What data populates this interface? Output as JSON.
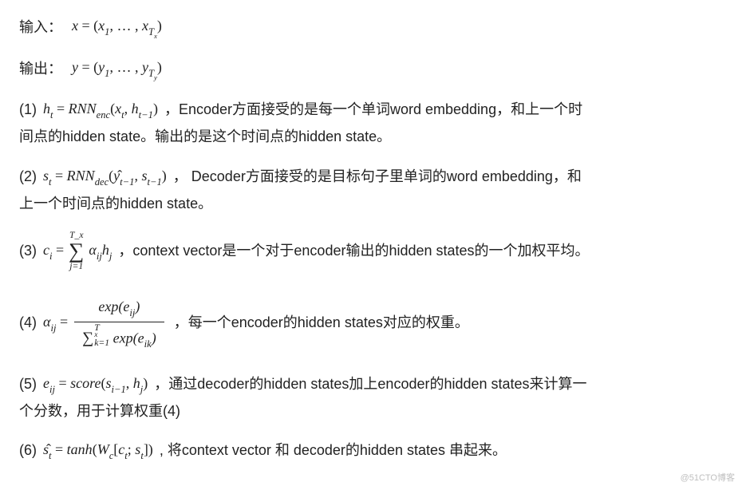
{
  "input_label": "输入：",
  "input_formula": "x = (x₁, …, x_{T_x})",
  "output_label": "输出：",
  "output_formula": "y = (y₁, …, y_{T_y})",
  "items": [
    {
      "num": "(1)",
      "formula": "h_t = RNN_{enc}(x_t, h_{t-1})",
      "desc": "，Encoder方面接受的是每一个单词word embedding，和上一个时",
      "desc2": "间点的hidden state。输出的是这个时间点的hidden state。"
    },
    {
      "num": "(2)",
      "formula": "s_t = RNN_{dec}(ŷ_{t-1}, s_{t-1})",
      "desc": "，  Decoder方面接受的是目标句子里单词的word embedding，和",
      "desc2": "上一个时间点的hidden state。"
    },
    {
      "num": "(3)",
      "formula_sum_top": "T_x",
      "formula_sum_bot": "j=1",
      "formula_lhs": "c_i =",
      "formula_rhs": "α_{ij} h_j",
      "desc": "，context vector是一个对于encoder输出的hidden states的一个加权平均。"
    },
    {
      "num": "(4)",
      "formula_lhs": "α_{ij} =",
      "frac_top": "exp(e_{ij})",
      "frac_bot_sum_top": "T_x",
      "frac_bot_sum_bot": "k=1",
      "frac_bot_rest": "exp(e_{ik})",
      "desc": "，每一个encoder的hidden states对应的权重。"
    },
    {
      "num": "(5)",
      "formula": "e_{ij} = score(s_{i-1}, h_j)",
      "desc": "，通过decoder的hidden states加上encoder的hidden states来计算一",
      "desc2": "个分数，用于计算权重(4)"
    },
    {
      "num": "(6)",
      "formula": "ŝ_t = tanh(W_c[c_t; s_t])",
      "desc": " , 将context vector 和 decoder的hidden states 串起来。"
    }
  ],
  "footer": "@51CTO博客"
}
